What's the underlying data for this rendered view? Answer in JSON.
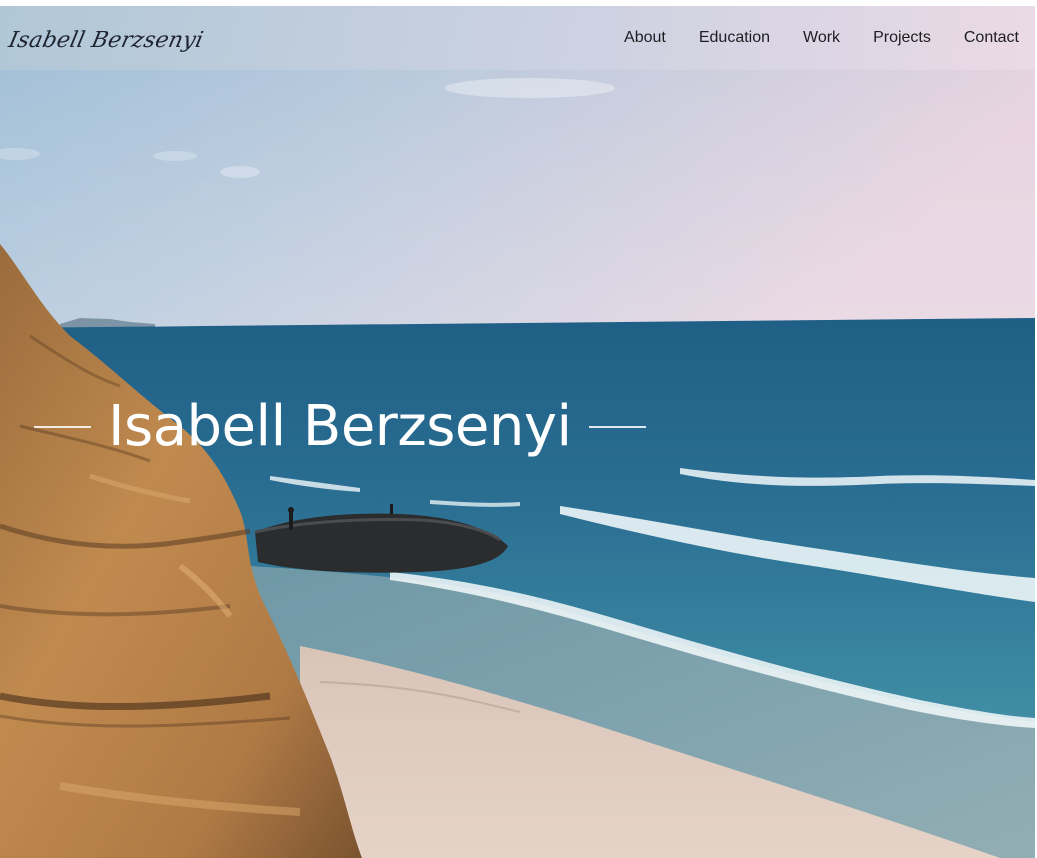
{
  "brand": {
    "name": "Isabell Berzsenyi"
  },
  "nav": {
    "items": [
      {
        "label": "About"
      },
      {
        "label": "Education"
      },
      {
        "label": "Work"
      },
      {
        "label": "Projects"
      },
      {
        "label": "Contact"
      }
    ]
  },
  "hero": {
    "title": "Isabell Berzsenyi",
    "background": "coastal-beach-photo"
  }
}
